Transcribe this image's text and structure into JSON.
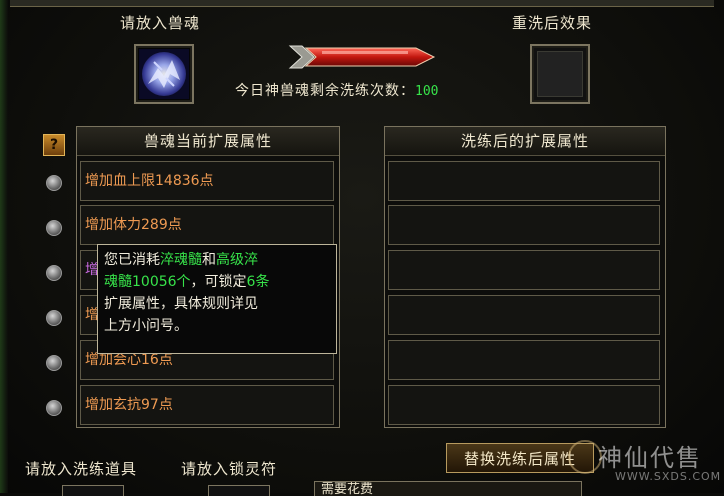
{
  "top": {
    "place_soul_label": "请放入兽魂",
    "result_label": "重洗后效果",
    "counter_prefix": "今日神兽魂剩余洗练次数：",
    "counter_value": "100"
  },
  "help_button": "?",
  "left_panel": {
    "title": "兽魂当前扩展属性",
    "rows": [
      "增加血上限14836点",
      "增加体力289点",
      "增",
      "增",
      "增加会心16点",
      "增加玄抗97点"
    ]
  },
  "right_panel": {
    "title": "洗练后的扩展属性"
  },
  "tooltip": {
    "line1_a": "您已消耗",
    "line1_b": "淬魂髓",
    "line1_c": "和",
    "line1_d": "高级淬",
    "line2_a": "魂髓10056个",
    "line2_b": "，可锁定",
    "line2_c": "6条",
    "line3": "扩展属性，具体规则详见",
    "line4": "上方小问号。"
  },
  "swap_button": "替换洗练后属性",
  "bottom": {
    "wash_item_label": "请放入洗练道具",
    "lock_label": "请放入锁灵符",
    "panel_text": "需要花费"
  },
  "watermark": {
    "text": "神仙代售",
    "url": "WWW.SXDS.COM"
  },
  "colors": {
    "attr_text": "#ee9a52",
    "highlight_green": "#37e34a",
    "border": "#7a735e"
  }
}
